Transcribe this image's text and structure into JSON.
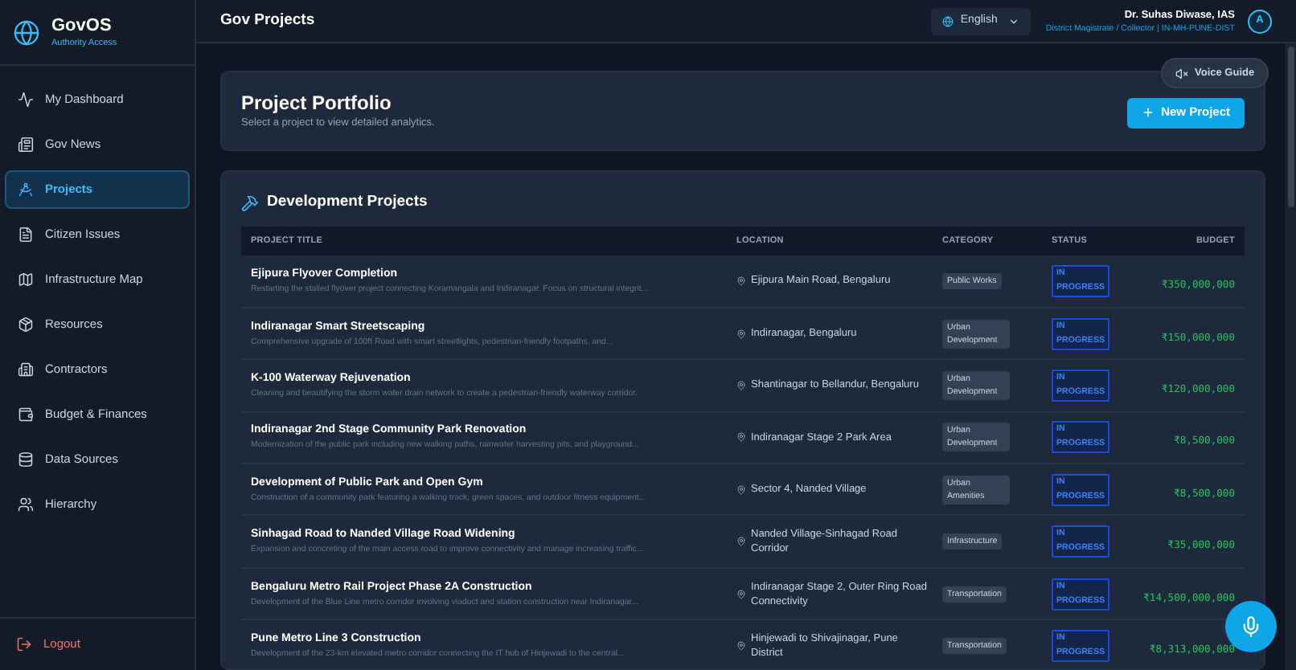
{
  "app": {
    "name": "GovOS",
    "subtitle": "Authority Access"
  },
  "sidebar": {
    "items": [
      {
        "label": "My Dashboard",
        "selected": false
      },
      {
        "label": "Gov News",
        "selected": false
      },
      {
        "label": "Projects",
        "selected": true
      },
      {
        "label": "Citizen Issues",
        "selected": false
      },
      {
        "label": "Infrastructure Map",
        "selected": false
      },
      {
        "label": "Resources",
        "selected": false
      },
      {
        "label": "Contractors",
        "selected": false
      },
      {
        "label": "Budget & Finances",
        "selected": false
      },
      {
        "label": "Data Sources",
        "selected": false
      },
      {
        "label": "Hierarchy",
        "selected": false
      }
    ],
    "logout": "Logout"
  },
  "header": {
    "title": "Gov Projects",
    "language": "English",
    "user_name": "Dr. Suhas Diwase, IAS",
    "user_role": "District Magistrate / Collector | IN-MH-PUNE-DIST",
    "avatar": "A"
  },
  "voice_guide": "Voice Guide",
  "portfolio": {
    "title": "Project Portfolio",
    "subtitle": "Select a project to view detailed analytics.",
    "button": "New Project"
  },
  "section_title": "Development Projects",
  "table": {
    "columns": [
      "PROJECT TITLE",
      "LOCATION",
      "CATEGORY",
      "STATUS",
      "BUDGET"
    ],
    "rows": [
      {
        "title": "Ejipura Flyover Completion",
        "description": "Restarting the stalled flyover project connecting Koramangala and Indiranagar. Focus on structural integrit...",
        "location": "Ejipura Main Road, Bengaluru",
        "category": "Public Works",
        "status": "IN PROGRESS",
        "budget": "₹350,000,000"
      },
      {
        "title": "Indiranagar Smart Streetscaping",
        "description": "Comprehensive upgrade of 100ft Road with smart streetlights, pedestrian-friendly footpaths, and...",
        "location": "Indiranagar, Bengaluru",
        "category": "Urban Development",
        "status": "IN PROGRESS",
        "budget": "₹150,000,000"
      },
      {
        "title": "K-100 Waterway Rejuvenation",
        "description": "Cleaning and beautifying the storm water drain network to create a pedestrian-friendly waterway corridor.",
        "location": "Shantinagar to Bellandur, Bengaluru",
        "category": "Urban Development",
        "status": "IN PROGRESS",
        "budget": "₹120,000,000"
      },
      {
        "title": "Indiranagar 2nd Stage Community Park Renovation",
        "description": "Modernization of the public park including new walking paths, rainwater harvesting pits, and playground...",
        "location": "Indiranagar Stage 2 Park Area",
        "category": "Urban Development",
        "status": "IN PROGRESS",
        "budget": "₹8,500,000"
      },
      {
        "title": "Development of Public Park and Open Gym",
        "description": "Construction of a community park featuring a walking track, green spaces, and outdoor fitness equipment...",
        "location": "Sector 4, Nanded Village",
        "category": "Urban Amenities",
        "status": "IN PROGRESS",
        "budget": "₹8,500,000"
      },
      {
        "title": "Sinhagad Road to Nanded Village Road Widening",
        "description": "Expansion and concreting of the main access road to improve connectivity and manage increasing traffic...",
        "location": "Nanded Village-Sinhagad Road Corridor",
        "category": "Infrastructure",
        "status": "IN PROGRESS",
        "budget": "₹35,000,000"
      },
      {
        "title": "Bengaluru Metro Rail Project Phase 2A Construction",
        "description": "Development of the Blue Line metro corridor involving viaduct and station construction near Indiranagar...",
        "location": "Indiranagar Stage 2, Outer Ring Road Connectivity",
        "category": "Transportation",
        "status": "IN PROGRESS",
        "budget": "₹14,500,000,000"
      },
      {
        "title": "Pune Metro Line 3 Construction",
        "description": "Development of the 23-km elevated metro corridor connecting the IT hub of Hinjewadi to the central...",
        "location": "Hinjewadi to Shivajinagar, Pune District",
        "category": "Transportation",
        "status": "IN PROGRESS",
        "budget": "₹8,313,000,000"
      }
    ]
  }
}
